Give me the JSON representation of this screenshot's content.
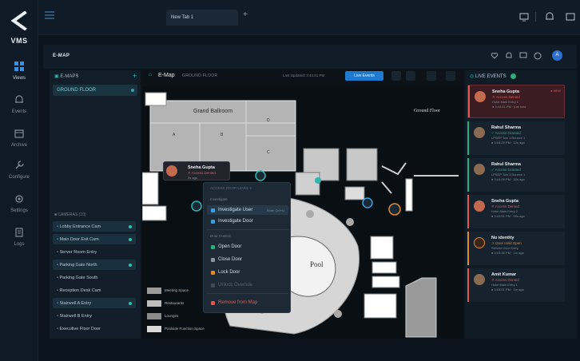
{
  "app": {
    "name": "VMS"
  },
  "nav": [
    {
      "label": "Views",
      "icon": "grid-icon"
    },
    {
      "label": "Events",
      "icon": "bell-icon"
    },
    {
      "label": "Archive",
      "icon": "archive-icon"
    },
    {
      "label": "Configure",
      "icon": "wrench-icon"
    },
    {
      "label": "Settings",
      "icon": "gear-icon"
    },
    {
      "label": "Logs",
      "icon": "log-icon"
    }
  ],
  "tabs": [
    {
      "label": "New Tab 1"
    }
  ],
  "page": {
    "title": "E-MAP",
    "avatar": "A"
  },
  "emaps": {
    "header": "E-MAPS",
    "floors": [
      {
        "label": "GROUND FLOOR"
      }
    ],
    "cameras_header": "CAMERAS (10)",
    "cameras": [
      "Lobby Entrance Cam",
      "Main Door Exit Cam",
      "Server Room Entry",
      "Parking Gate North",
      "Parking Gate South",
      "Reception Desk Cam",
      "Stairwell A Entry",
      "Stairwell B Entry",
      "Executive Floor Door"
    ]
  },
  "map": {
    "title": "E-Map",
    "subtitle": "GROUND FLOOR",
    "updated": "Last Updated: 3:44:41 PM",
    "live_button": "Live Events",
    "rooms": {
      "grand_ballroom": "Grand Ballroom",
      "a": "A",
      "b": "B",
      "c": "C",
      "d": "D",
      "pool": "Pool",
      "ground_floor": "Ground Floor"
    },
    "legend": [
      {
        "label": "Meeting Space",
        "color": "#9b9b9b"
      },
      {
        "label": "Restaurants",
        "color": "#bdbdbd"
      },
      {
        "label": "Lounges",
        "color": "#8a8a8a"
      },
      {
        "label": "Poolside Function Space",
        "color": "#d8d8d8"
      }
    ]
  },
  "popup": {
    "name": "Sneha Gupta",
    "status": "✕ Access Denied",
    "time": "3s ago"
  },
  "context_menu": {
    "header": "ACCESS DOOR LEVEL 1",
    "section_investigate": "Investigate",
    "investigate_user": "Investigate User",
    "investigate_user_shortcut": "Enter Ctrl+U",
    "investigate_door": "Investigate Door",
    "section_door": "Door Control",
    "open_door": "Open Door",
    "close_door": "Close Door",
    "lock_door": "Lock Door",
    "unlock": "Unlock Override",
    "remove": "Remove from Map"
  },
  "events": {
    "header": "LIVE EVENTS",
    "items": [
      {
        "name": "Sneha Gupta",
        "status": "✕ Access Denied",
        "location": "Hotel Main Entry 1",
        "time": "● 3:44:41 PM · just now",
        "new": "● NEW",
        "kind": "denied"
      },
      {
        "name": "Rahul Sharma",
        "status": "✓ Access Granted",
        "location": "LPSEP Tow 1 Bounce 1",
        "time": "● 3:44:29 PM · 12s ago",
        "kind": "granted"
      },
      {
        "name": "Rahul Sharma",
        "status": "✓ Access Granted",
        "location": "LPSEP Tow 1 Bounce 1",
        "time": "● 3:44:09 PM · 32s ago",
        "kind": "granted"
      },
      {
        "name": "Sneha Gupta",
        "status": "✕ Access Denied",
        "location": "Hotel Main Entry 2",
        "time": "● 3:43:51 PM · 50s ago",
        "kind": "denied"
      },
      {
        "name": "No identity",
        "status": "⚠ Door Held Open",
        "location": "Service Door Entry",
        "time": "● 3:43:30 PM · 1m ago",
        "kind": "warning"
      },
      {
        "name": "Amit Kumar",
        "status": "✕ Access Denied",
        "location": "Hotel Main Entry 1",
        "time": "● 3:43:01 PM · 1m ago",
        "kind": "denied"
      }
    ]
  },
  "colors": {
    "accent": "#1f7acf",
    "teal": "#2bb6b0",
    "denied": "#e0574f",
    "granted": "#27b07a",
    "warning": "#e08a2a"
  }
}
